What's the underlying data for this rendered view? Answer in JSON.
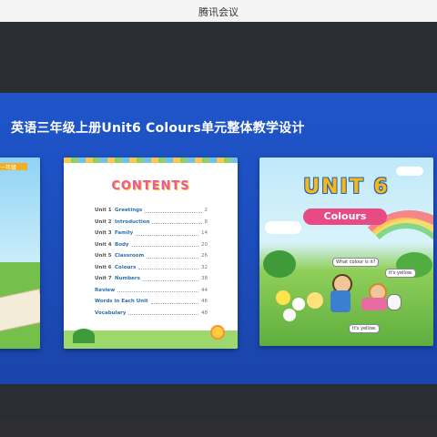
{
  "window": {
    "title": "腾讯会议"
  },
  "slide": {
    "title": "英语三年级上册Unit6 Colours单元整体教学设计",
    "left_book": {
      "tag": "一年级"
    },
    "contents_book": {
      "heading": "CONTENTS",
      "toc": [
        {
          "unit": "Unit 1",
          "name": "Greetings",
          "page": "2"
        },
        {
          "unit": "Unit 2",
          "name": "Introduction",
          "page": "8"
        },
        {
          "unit": "Unit 3",
          "name": "Family",
          "page": "14"
        },
        {
          "unit": "Unit 4",
          "name": "Body",
          "page": "20"
        },
        {
          "unit": "Unit 5",
          "name": "Classroom",
          "page": "26"
        },
        {
          "unit": "Unit 6",
          "name": "Colours",
          "page": "32"
        },
        {
          "unit": "Unit 7",
          "name": "Numbers",
          "page": "38"
        },
        {
          "unit": "",
          "name": "Review",
          "page": "44"
        },
        {
          "unit": "",
          "name": "Words in Each Unit",
          "page": "46"
        },
        {
          "unit": "",
          "name": "Vocabulary",
          "page": "48"
        }
      ]
    },
    "unit_book": {
      "heading": "UNIT 6",
      "subtitle": "Colours",
      "bubbles": [
        "What colour is it?",
        "It's yellow.",
        "It's yellow."
      ]
    }
  },
  "colors": {
    "slide_blue": "#1f55c9",
    "unit_yellow": "#f5b91a",
    "subtitle_pink": "#e84a85"
  }
}
